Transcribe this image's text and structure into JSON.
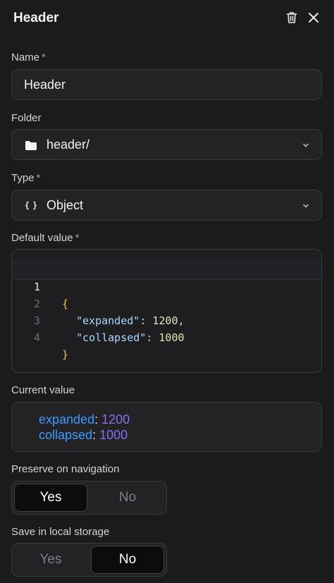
{
  "panel": {
    "title": "Header",
    "actions": {
      "delete_icon": "trash-icon",
      "close_icon": "close-icon"
    }
  },
  "name_field": {
    "label": "Name",
    "required": "*",
    "value": "Header"
  },
  "folder_field": {
    "label": "Folder",
    "icon": "folder-icon",
    "value": "header/"
  },
  "type_field": {
    "label": "Type",
    "required": "*",
    "icon": "braces-icon",
    "value": "Object"
  },
  "default_value": {
    "label": "Default value",
    "required": "*",
    "lines": [
      {
        "number": "1",
        "brace": "{"
      },
      {
        "number": "2",
        "key": "\"expanded\"",
        "colon": ": ",
        "value": "1200",
        "comma": ","
      },
      {
        "number": "3",
        "key": "\"collapsed\"",
        "colon": ": ",
        "value": "1000"
      },
      {
        "number": "4",
        "brace": "}"
      }
    ]
  },
  "current_value": {
    "label": "Current value",
    "rows": [
      {
        "key": "expanded",
        "colon": ":",
        "value": "1200"
      },
      {
        "key": "collapsed",
        "colon": ":",
        "value": "1000"
      }
    ]
  },
  "preserve_on_navigation": {
    "label": "Preserve on navigation",
    "options": [
      "Yes",
      "No"
    ],
    "selected": "Yes"
  },
  "save_in_local_storage": {
    "label": "Save in local storage",
    "options": [
      "Yes",
      "No"
    ],
    "selected": "No"
  },
  "colors": {
    "background": "#1b1b1d",
    "key_blue": "#3b9cff",
    "value_purple": "#8a6cf0",
    "code_brace": "#f2c94c",
    "code_key": "#a8d8ff"
  }
}
